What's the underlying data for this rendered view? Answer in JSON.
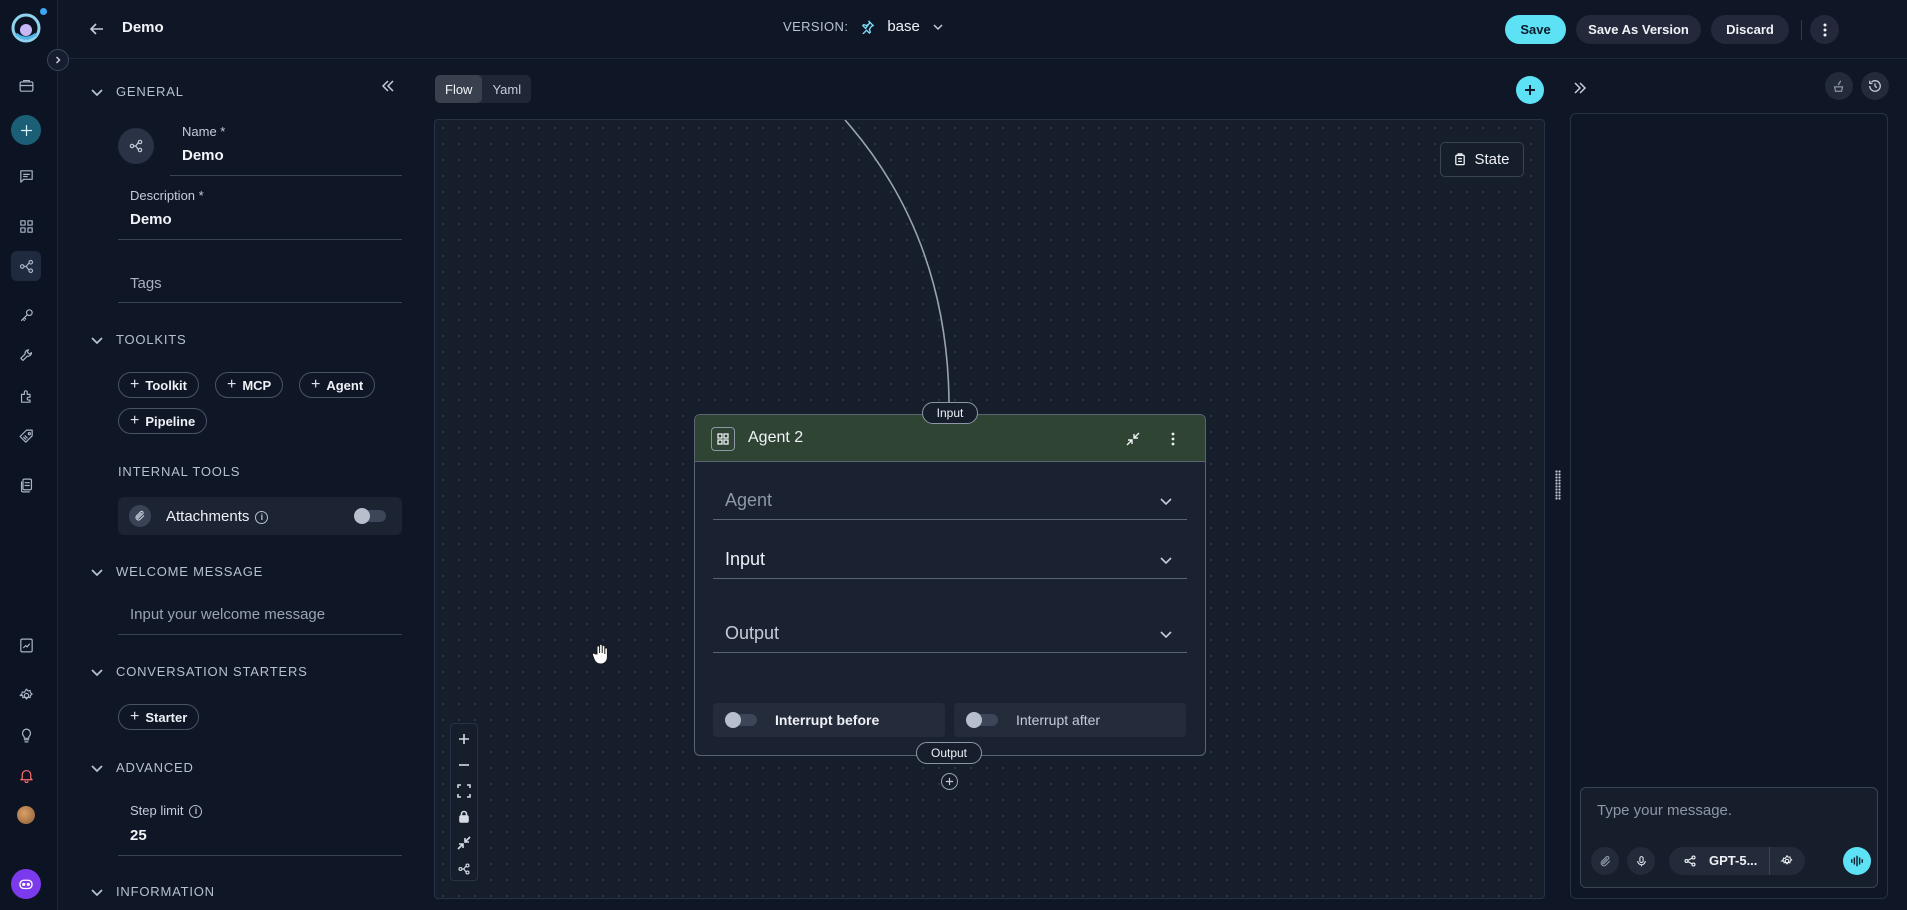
{
  "header": {
    "title": "Demo",
    "version_label": "VERSION:",
    "version_value": "base",
    "save": "Save",
    "save_as_version": "Save As Version",
    "discard": "Discard"
  },
  "general": {
    "section": "GENERAL",
    "name_label": "Name *",
    "name_value": "Demo",
    "description_label": "Description *",
    "description_value": "Demo",
    "tags_placeholder": "Tags"
  },
  "toolkits": {
    "section": "TOOLKITS",
    "chips": [
      "Toolkit",
      "MCP",
      "Agent",
      "Pipeline"
    ],
    "internal_tools": "INTERNAL TOOLS",
    "attachments_label": "Attachments",
    "attachments_enabled": false
  },
  "welcome": {
    "section": "WELCOME MESSAGE",
    "placeholder": "Input your welcome message"
  },
  "starters": {
    "section": "CONVERSATION STARTERS",
    "chip": "Starter"
  },
  "advanced": {
    "section": "ADVANCED",
    "step_limit_label": "Step limit",
    "step_limit_value": "25"
  },
  "information": {
    "section": "INFORMATION"
  },
  "canvas": {
    "tabs": [
      {
        "label": "Flow",
        "active": true
      },
      {
        "label": "Yaml",
        "active": false
      }
    ],
    "state_button": "State",
    "node": {
      "title": "Agent 2",
      "header_color": "#2f4433",
      "input_handle": "Input",
      "output_handle": "Output",
      "agent_select": "Agent",
      "input_select": "Input",
      "output_select": "Output",
      "interrupt_before": "Interrupt before",
      "interrupt_after": "Interrupt after",
      "interrupt_before_enabled": false,
      "interrupt_after_enabled": false
    }
  },
  "chat": {
    "placeholder": "Type your message.",
    "model": "GPT-5..."
  },
  "colors": {
    "accent": "#5ce1f5",
    "background": "#0f1626",
    "canvas": "#161d2b"
  },
  "icons": {
    "rail": [
      "logo",
      "briefcase-icon",
      "plus-icon",
      "chat-icon",
      "grid-icon",
      "pipeline-icon",
      "key-icon",
      "wrench-icon",
      "puzzle-icon",
      "tag-icon",
      "docs-icon",
      "report-icon",
      "settings-icon",
      "bulb-icon",
      "bell-icon",
      "avatar",
      "bot-icon"
    ]
  }
}
